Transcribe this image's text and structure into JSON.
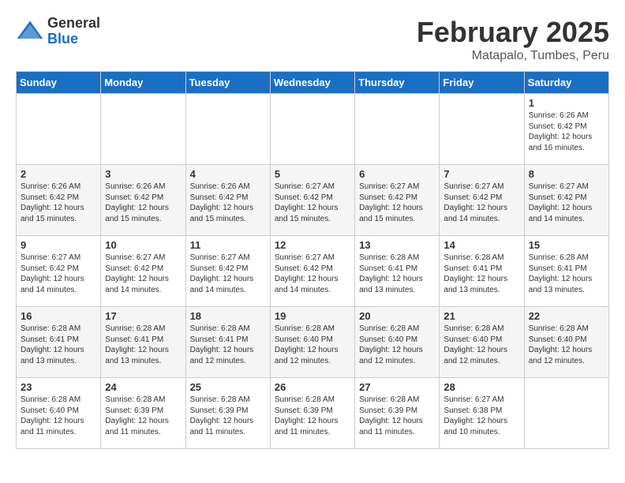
{
  "header": {
    "logo_general": "General",
    "logo_blue": "Blue",
    "month_title": "February 2025",
    "subtitle": "Matapalo, Tumbes, Peru"
  },
  "days_of_week": [
    "Sunday",
    "Monday",
    "Tuesday",
    "Wednesday",
    "Thursday",
    "Friday",
    "Saturday"
  ],
  "weeks": [
    [
      {
        "day": "",
        "info": ""
      },
      {
        "day": "",
        "info": ""
      },
      {
        "day": "",
        "info": ""
      },
      {
        "day": "",
        "info": ""
      },
      {
        "day": "",
        "info": ""
      },
      {
        "day": "",
        "info": ""
      },
      {
        "day": "1",
        "info": "Sunrise: 6:26 AM\nSunset: 6:42 PM\nDaylight: 12 hours and 16 minutes."
      }
    ],
    [
      {
        "day": "2",
        "info": "Sunrise: 6:26 AM\nSunset: 6:42 PM\nDaylight: 12 hours and 15 minutes."
      },
      {
        "day": "3",
        "info": "Sunrise: 6:26 AM\nSunset: 6:42 PM\nDaylight: 12 hours and 15 minutes."
      },
      {
        "day": "4",
        "info": "Sunrise: 6:26 AM\nSunset: 6:42 PM\nDaylight: 12 hours and 15 minutes."
      },
      {
        "day": "5",
        "info": "Sunrise: 6:27 AM\nSunset: 6:42 PM\nDaylight: 12 hours and 15 minutes."
      },
      {
        "day": "6",
        "info": "Sunrise: 6:27 AM\nSunset: 6:42 PM\nDaylight: 12 hours and 15 minutes."
      },
      {
        "day": "7",
        "info": "Sunrise: 6:27 AM\nSunset: 6:42 PM\nDaylight: 12 hours and 14 minutes."
      },
      {
        "day": "8",
        "info": "Sunrise: 6:27 AM\nSunset: 6:42 PM\nDaylight: 12 hours and 14 minutes."
      }
    ],
    [
      {
        "day": "9",
        "info": "Sunrise: 6:27 AM\nSunset: 6:42 PM\nDaylight: 12 hours and 14 minutes."
      },
      {
        "day": "10",
        "info": "Sunrise: 6:27 AM\nSunset: 6:42 PM\nDaylight: 12 hours and 14 minutes."
      },
      {
        "day": "11",
        "info": "Sunrise: 6:27 AM\nSunset: 6:42 PM\nDaylight: 12 hours and 14 minutes."
      },
      {
        "day": "12",
        "info": "Sunrise: 6:27 AM\nSunset: 6:42 PM\nDaylight: 12 hours and 14 minutes."
      },
      {
        "day": "13",
        "info": "Sunrise: 6:28 AM\nSunset: 6:41 PM\nDaylight: 12 hours and 13 minutes."
      },
      {
        "day": "14",
        "info": "Sunrise: 6:28 AM\nSunset: 6:41 PM\nDaylight: 12 hours and 13 minutes."
      },
      {
        "day": "15",
        "info": "Sunrise: 6:28 AM\nSunset: 6:41 PM\nDaylight: 12 hours and 13 minutes."
      }
    ],
    [
      {
        "day": "16",
        "info": "Sunrise: 6:28 AM\nSunset: 6:41 PM\nDaylight: 12 hours and 13 minutes."
      },
      {
        "day": "17",
        "info": "Sunrise: 6:28 AM\nSunset: 6:41 PM\nDaylight: 12 hours and 13 minutes."
      },
      {
        "day": "18",
        "info": "Sunrise: 6:28 AM\nSunset: 6:41 PM\nDaylight: 12 hours and 12 minutes."
      },
      {
        "day": "19",
        "info": "Sunrise: 6:28 AM\nSunset: 6:40 PM\nDaylight: 12 hours and 12 minutes."
      },
      {
        "day": "20",
        "info": "Sunrise: 6:28 AM\nSunset: 6:40 PM\nDaylight: 12 hours and 12 minutes."
      },
      {
        "day": "21",
        "info": "Sunrise: 6:28 AM\nSunset: 6:40 PM\nDaylight: 12 hours and 12 minutes."
      },
      {
        "day": "22",
        "info": "Sunrise: 6:28 AM\nSunset: 6:40 PM\nDaylight: 12 hours and 12 minutes."
      }
    ],
    [
      {
        "day": "23",
        "info": "Sunrise: 6:28 AM\nSunset: 6:40 PM\nDaylight: 12 hours and 11 minutes."
      },
      {
        "day": "24",
        "info": "Sunrise: 6:28 AM\nSunset: 6:39 PM\nDaylight: 12 hours and 11 minutes."
      },
      {
        "day": "25",
        "info": "Sunrise: 6:28 AM\nSunset: 6:39 PM\nDaylight: 12 hours and 11 minutes."
      },
      {
        "day": "26",
        "info": "Sunrise: 6:28 AM\nSunset: 6:39 PM\nDaylight: 12 hours and 11 minutes."
      },
      {
        "day": "27",
        "info": "Sunrise: 6:28 AM\nSunset: 6:39 PM\nDaylight: 12 hours and 11 minutes."
      },
      {
        "day": "28",
        "info": "Sunrise: 6:27 AM\nSunset: 6:38 PM\nDaylight: 12 hours and 10 minutes."
      },
      {
        "day": "",
        "info": ""
      }
    ]
  ]
}
